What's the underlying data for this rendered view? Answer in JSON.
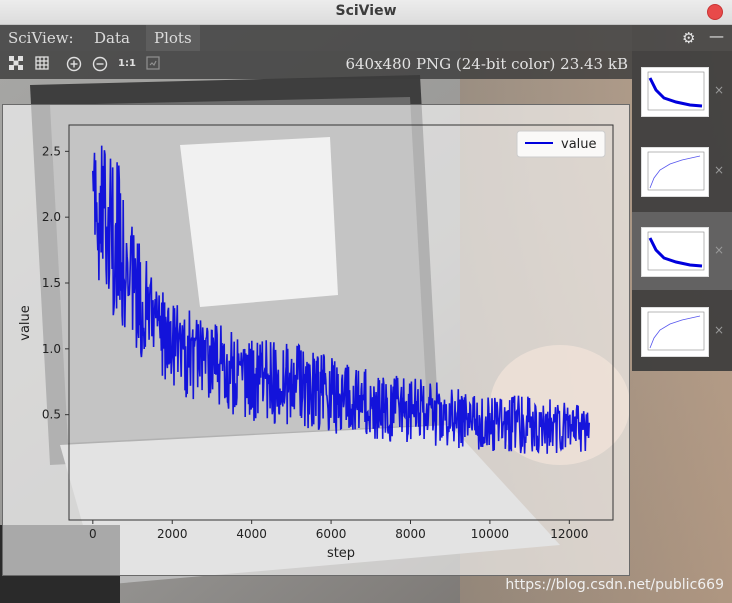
{
  "window": {
    "title": "SciView"
  },
  "menu": {
    "app_label": "SciView:",
    "data_label": "Data",
    "plots_label": "Plots"
  },
  "toolbar": {
    "actual_size_label": "1:1",
    "image_info": "640x480 PNG (24-bit color) 23.43 kB"
  },
  "watermark": "https://blog.csdn.net/public669",
  "colors": {
    "series": "#0000dd",
    "accent_close": "#e84a4a"
  },
  "chart_data": {
    "type": "line",
    "xlabel": "step",
    "ylabel": "value",
    "xlim": [
      -600,
      13100
    ],
    "ylim": [
      -0.3,
      2.7
    ],
    "xticks": [
      "0",
      "2000",
      "4000",
      "6000",
      "8000",
      "10000",
      "12000"
    ],
    "yticks": [
      "0.5",
      "1.0",
      "1.5",
      "2.0",
      "2.5"
    ],
    "legend": "top-right",
    "series": [
      {
        "name": "value",
        "x": [
          0,
          200,
          500,
          1000,
          1500,
          2000,
          2500,
          3000,
          4000,
          5000,
          6000,
          7000,
          8000,
          9000,
          10000,
          11000,
          12000,
          12500
        ],
        "y_mean": [
          2.1,
          1.85,
          1.65,
          1.4,
          1.25,
          1.1,
          0.98,
          0.9,
          0.8,
          0.72,
          0.65,
          0.58,
          0.52,
          0.48,
          0.44,
          0.42,
          0.4,
          0.38
        ],
        "y_min": [
          1.7,
          1.45,
          1.25,
          1.0,
          0.85,
          0.7,
          0.6,
          0.55,
          0.45,
          0.4,
          0.35,
          0.3,
          0.28,
          0.25,
          0.22,
          0.2,
          0.2,
          0.18
        ],
        "y_max": [
          2.55,
          2.55,
          2.6,
          1.95,
          1.55,
          1.35,
          1.3,
          1.2,
          1.1,
          1.05,
          0.95,
          0.85,
          0.8,
          0.72,
          0.68,
          0.65,
          0.6,
          0.58
        ]
      }
    ]
  }
}
